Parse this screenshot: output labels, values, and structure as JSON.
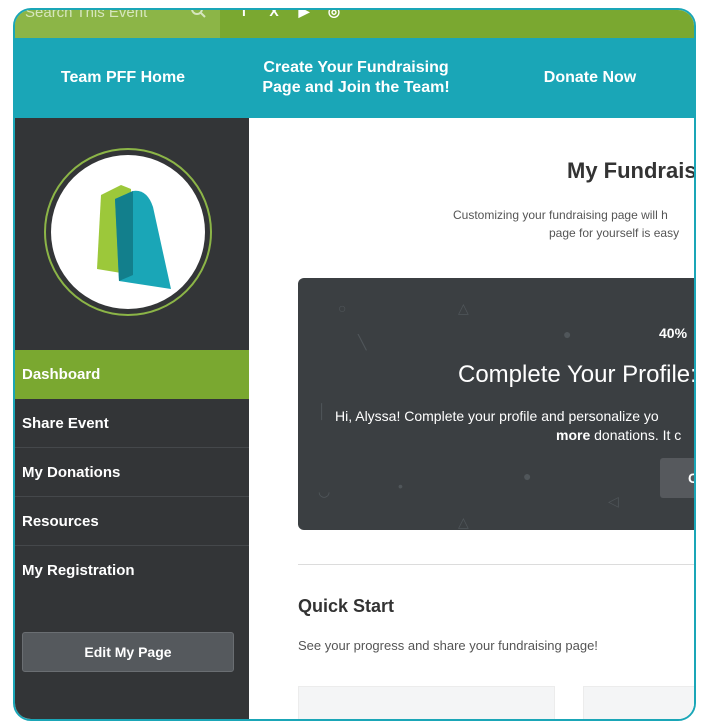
{
  "topbar": {
    "search_placeholder": "Search This Event",
    "social": [
      "f",
      "X",
      "▶",
      "◎"
    ]
  },
  "nav": {
    "home": "Team PFF Home",
    "create": "Create Your Fundraising Page and Join the Team!",
    "donate": "Donate Now"
  },
  "sidebar": {
    "items": [
      {
        "label": "Dashboard"
      },
      {
        "label": "Share Event"
      },
      {
        "label": "My Donations"
      },
      {
        "label": "Resources"
      },
      {
        "label": "My Registration"
      }
    ],
    "edit_button": "Edit My Page"
  },
  "main": {
    "title": "My Fundrais",
    "intro_line1": "Customizing your fundraising page will h",
    "intro_line2": "page for yourself is easy",
    "profile": {
      "percent": "40%",
      "title": "Complete Your Profile:",
      "line1": "Hi, Alyssa! Complete your profile and personalize yo",
      "line2_bold": "more",
      "line2_rest": " donations. It c",
      "button": "C"
    },
    "quick_start": {
      "title": "Quick Start",
      "text": "See your progress and share your fundraising page!"
    }
  },
  "colors": {
    "teal": "#1aa6b7",
    "green": "#7aa830",
    "sidebar": "#333537"
  }
}
